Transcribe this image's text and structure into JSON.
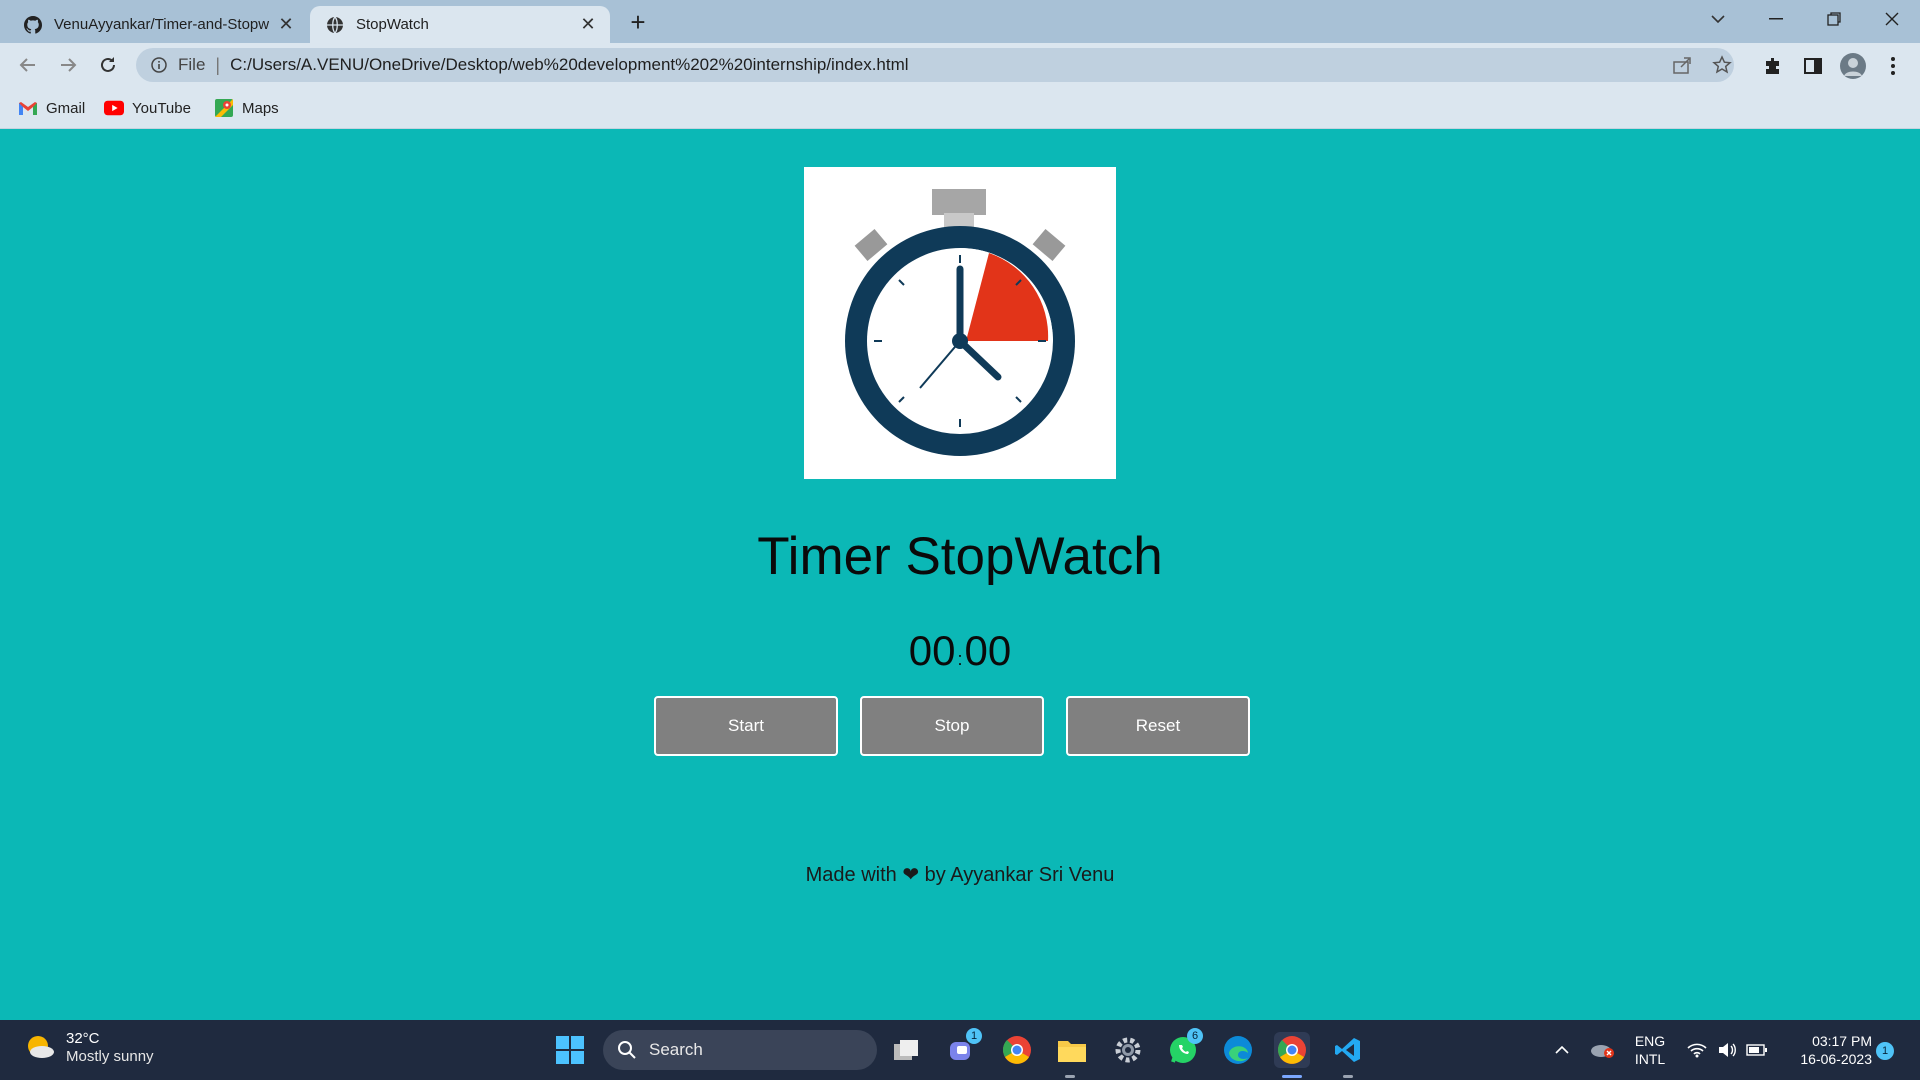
{
  "browser": {
    "tabs": [
      {
        "title": "VenuAyyankar/Timer-and-Stopw",
        "favicon": "github-icon",
        "active": false
      },
      {
        "title": "StopWatch",
        "favicon": "globe-icon",
        "active": true
      }
    ],
    "address": {
      "scheme": "File",
      "url": "C:/Users/A.VENU/OneDrive/Desktop/web%20development%202%20internship/index.html"
    },
    "bookmarks": [
      {
        "label": "Gmail",
        "icon": "gmail-icon"
      },
      {
        "label": "YouTube",
        "icon": "youtube-icon"
      },
      {
        "label": "Maps",
        "icon": "maps-icon"
      }
    ]
  },
  "page": {
    "title": "Timer StopWatch",
    "timer": {
      "minutes": "00",
      "separator": ":",
      "seconds": "00"
    },
    "buttons": {
      "start": "Start",
      "stop": "Stop",
      "reset": "Reset"
    },
    "footer": "Made with ❤ by Ayyankar Sri Venu",
    "colors": {
      "background": "#0bb8b6",
      "button": "#808080",
      "accent": "#e23419",
      "clock_ring": "#0f3a58"
    }
  },
  "taskbar": {
    "weather": {
      "temp": "32°C",
      "condition": "Mostly sunny"
    },
    "search_label": "Search",
    "badges": {
      "teams": "1",
      "whatsapp": "6"
    },
    "language": {
      "line1": "ENG",
      "line2": "INTL"
    },
    "time": "03:17 PM",
    "date": "16-06-2023",
    "notifications": "1"
  }
}
